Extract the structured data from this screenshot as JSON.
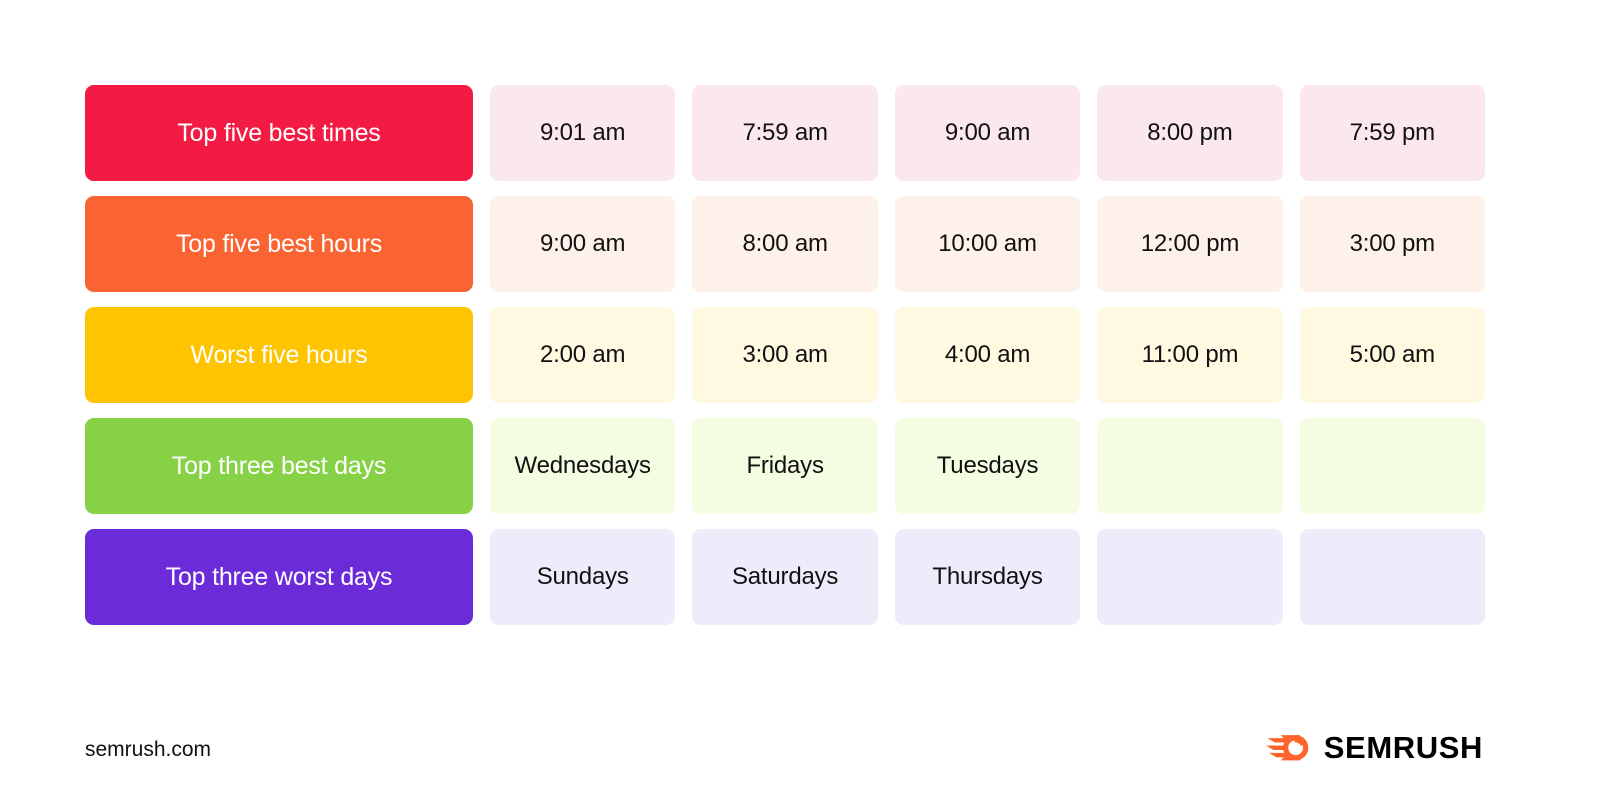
{
  "table": {
    "rows": [
      {
        "label": "Top five best times",
        "label_bg": "#F31B44",
        "cell_bg": "#FBE8EC",
        "cells": [
          "9:01 am",
          "7:59 am",
          "9:00 am",
          "8:00 pm",
          "7:59 pm"
        ]
      },
      {
        "label": "Top five best hours",
        "label_bg": "#FA6432",
        "cell_bg": "#FDF1E9",
        "cells": [
          "9:00 am",
          "8:00 am",
          "10:00 am",
          "12:00 pm",
          "3:00 pm"
        ]
      },
      {
        "label": "Worst five hours",
        "label_bg": "#FFC400",
        "cell_bg": "#FFF9E2",
        "cells": [
          "2:00 am",
          "3:00 am",
          "4:00 am",
          "11:00 pm",
          "5:00 am"
        ]
      },
      {
        "label": "Top three best days",
        "label_bg": "#87D147",
        "cell_bg": "#F4FCE2",
        "cells": [
          "Wednesdays",
          "Fridays",
          "Tuesdays",
          "",
          ""
        ]
      },
      {
        "label": "Top three worst days",
        "label_bg": "#6B2BD9",
        "cell_bg": "#F0EBFA",
        "cells": [
          "Sundays",
          "Saturdays",
          "Thursdays",
          "",
          ""
        ]
      }
    ]
  },
  "footer": {
    "url": "semrush.com",
    "brand_name": "SEMRUSH",
    "brand_color": "#FF642D",
    "brand_text_color": "#000000"
  }
}
